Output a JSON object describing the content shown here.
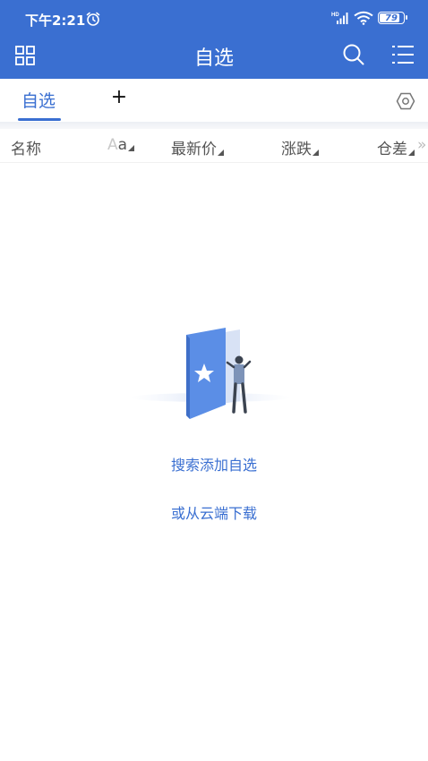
{
  "status_bar": {
    "time": "下午2:21",
    "battery": "79",
    "signal_badge": "HD"
  },
  "header": {
    "title": "自选"
  },
  "tabs": {
    "active_label": "自选",
    "add_label": "+"
  },
  "columns": {
    "name": "名称",
    "font_toggle_a": "A",
    "font_toggle_b": "a",
    "last_price": "最新价",
    "change": "涨跌",
    "position_diff": "仓差",
    "more": "»"
  },
  "empty_state": {
    "search_add": "搜索添加自选",
    "cloud_download": "或从云端下载"
  },
  "colors": {
    "primary": "#3a6fd1",
    "background": "#ffffff"
  },
  "icons": [
    "alarm-icon",
    "signal-icon",
    "wifi-icon",
    "battery-icon",
    "grid-icon",
    "search-icon",
    "menu-icon",
    "settings-icon",
    "empty-watchlist-illustration"
  ]
}
